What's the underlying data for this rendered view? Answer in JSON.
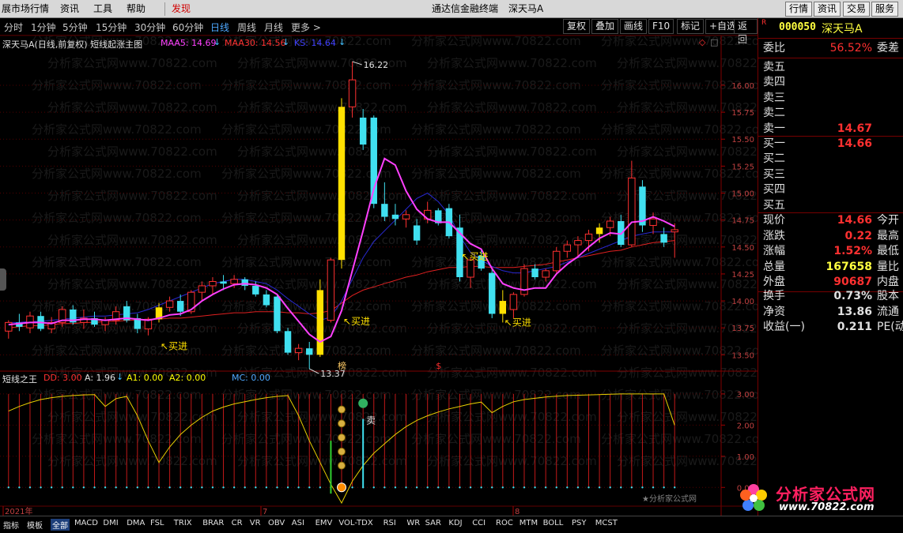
{
  "menubar": {
    "items": [
      "展市场行情",
      "资讯",
      "工具",
      "帮助"
    ],
    "discover": "发现",
    "app_title": "通达信金融终端",
    "stock_title": "深天马A",
    "right_buttons": [
      "行情",
      "资讯",
      "交易",
      "服务"
    ]
  },
  "periodbar": {
    "periods": [
      "分时",
      "1分钟",
      "5分钟",
      "15分钟",
      "30分钟",
      "60分钟",
      "日线",
      "周线",
      "月线",
      "更多 >"
    ],
    "active": "日线",
    "tools": [
      "复权",
      "叠加",
      "画线",
      "F10",
      "标记",
      "+自选",
      "返回"
    ]
  },
  "main_chart": {
    "title": "深天马A(日线,前复权) 短线起涨主图",
    "ma_labels": [
      {
        "text": "MAA5: 14.69",
        "color": "#ff40ff"
      },
      {
        "text": "MAA30: 14.56",
        "color": "#ff3030"
      },
      {
        "text": "KS: 14.64",
        "color": "#4040ff"
      }
    ],
    "price_axis": [
      "16.00",
      "15.75",
      "15.50",
      "15.25",
      "15.00",
      "14.75",
      "14.50",
      "14.25",
      "14.00",
      "13.75",
      "13.50"
    ],
    "high_label": "16.22",
    "low_label": "13.37",
    "buy_label": "买进",
    "buy_label_2": "买进",
    "buy_label_3": "买进",
    "buy_label_4": "买进",
    "event_marks": [
      "榜",
      "$"
    ]
  },
  "sub_chart": {
    "title": "短线之王",
    "indicators": [
      {
        "text": "DD: 3.00",
        "color": "#ff3030"
      },
      {
        "text": "A: 1.96",
        "color": "#e0e0e0"
      },
      {
        "text": "A1: 0.00",
        "color": "#ffff00"
      },
      {
        "text": "A2: 0.00",
        "color": "#ffff00"
      },
      {
        "text": "MC: 0.00",
        "color": "#4ea8ff"
      }
    ],
    "axis": [
      "3.00",
      "2.00",
      "1.00",
      "0.00"
    ],
    "sell_label": "卖",
    "date_labels": [
      "2021年",
      "7",
      "8"
    ],
    "footer_mark": "★分析家公式网"
  },
  "panel": {
    "flag": "R",
    "code": "000050",
    "name": "深天马A",
    "rows1": [
      {
        "label": "委比",
        "value": "56.52%",
        "value_color": "#ff3030",
        "right": "委差"
      }
    ],
    "sell_rows": [
      {
        "label": "卖五",
        "value": ""
      },
      {
        "label": "卖四",
        "value": ""
      },
      {
        "label": "卖三",
        "value": ""
      },
      {
        "label": "卖二",
        "value": ""
      },
      {
        "label": "卖一",
        "value": "14.67"
      }
    ],
    "buy_rows": [
      {
        "label": "买一",
        "value": "14.66"
      },
      {
        "label": "买二",
        "value": ""
      },
      {
        "label": "买三",
        "value": ""
      },
      {
        "label": "买四",
        "value": ""
      },
      {
        "label": "买五",
        "value": ""
      }
    ],
    "stats": [
      {
        "label": "现价",
        "value": "14.66",
        "value_color": "#ff3030",
        "right": "今开"
      },
      {
        "label": "涨跌",
        "value": "0.22",
        "value_color": "#ff3030",
        "right": "最高"
      },
      {
        "label": "涨幅",
        "value": "1.52%",
        "value_color": "#ff3030",
        "right": "最低"
      },
      {
        "label": "总量",
        "value": "167658",
        "value_color": "#ffff40",
        "right": "量比"
      },
      {
        "label": "外盘",
        "value": "90687",
        "value_color": "#ff3030",
        "right": "内盘"
      }
    ],
    "stats2": [
      {
        "label": "换手",
        "value": "0.73%",
        "value_color": "#e0e0e0",
        "right": "股本"
      },
      {
        "label": "净资",
        "value": "13.86",
        "value_color": "#e0e0e0",
        "right": "流通"
      },
      {
        "label": "收益(一)",
        "value": "0.211",
        "value_color": "#e0e0e0",
        "right": "PE(动)"
      }
    ]
  },
  "tabbar": {
    "tabs": [
      "指标",
      "模板",
      "全部",
      "MACD",
      "DMI",
      "DMA",
      "FSL",
      "TRIX",
      "BRAR",
      "CR",
      "VR",
      "OBV",
      "ASI",
      "EMV",
      "VOL-TDX",
      "RSI",
      "WR",
      "SAR",
      "KDJ",
      "CCI",
      "ROC",
      "MTM",
      "BOLL",
      "PSY",
      "MCST"
    ],
    "active": "全部"
  },
  "logo": {
    "text": "分析家公式网",
    "url": "www.70822.com"
  },
  "watermark": "分析家公式网www.70822.com",
  "chart_data": {
    "type": "candlestick",
    "title": "深天马A(日线,前复权) 短线起涨主图",
    "ylim": [
      13.4,
      16.3
    ],
    "up_color": "#ff3030",
    "down_color": "#40e0f0",
    "candles": [
      {
        "o": 13.72,
        "h": 13.82,
        "l": 13.65,
        "c": 13.8
      },
      {
        "o": 13.8,
        "h": 13.88,
        "l": 13.72,
        "c": 13.76
      },
      {
        "o": 13.75,
        "h": 13.9,
        "l": 13.7,
        "c": 13.86
      },
      {
        "o": 13.86,
        "h": 13.9,
        "l": 13.72,
        "c": 13.74
      },
      {
        "o": 13.74,
        "h": 13.85,
        "l": 13.7,
        "c": 13.8
      },
      {
        "o": 13.8,
        "h": 13.95,
        "l": 13.76,
        "c": 13.92
      },
      {
        "o": 13.92,
        "h": 13.96,
        "l": 13.78,
        "c": 13.8
      },
      {
        "o": 13.8,
        "h": 13.92,
        "l": 13.74,
        "c": 13.84
      },
      {
        "o": 13.84,
        "h": 13.9,
        "l": 13.76,
        "c": 13.78
      },
      {
        "o": 13.78,
        "h": 13.85,
        "l": 13.72,
        "c": 13.82
      },
      {
        "o": 13.82,
        "h": 13.95,
        "l": 13.78,
        "c": 13.9
      },
      {
        "o": 13.95,
        "h": 14.0,
        "l": 13.8,
        "c": 13.82
      },
      {
        "o": 13.84,
        "h": 13.88,
        "l": 13.7,
        "c": 13.74
      },
      {
        "o": 13.74,
        "h": 13.85,
        "l": 13.68,
        "c": 13.83
      },
      {
        "o": 13.83,
        "h": 13.98,
        "l": 13.8,
        "c": 13.94
      },
      {
        "o": 13.94,
        "h": 14.04,
        "l": 13.9,
        "c": 14.0
      },
      {
        "o": 14.0,
        "h": 14.06,
        "l": 13.86,
        "c": 13.9
      },
      {
        "o": 13.9,
        "h": 14.1,
        "l": 13.88,
        "c": 14.08
      },
      {
        "o": 14.08,
        "h": 14.18,
        "l": 14.0,
        "c": 14.14
      },
      {
        "o": 14.14,
        "h": 14.22,
        "l": 14.06,
        "c": 14.18
      },
      {
        "o": 14.18,
        "h": 14.24,
        "l": 14.1,
        "c": 14.16
      },
      {
        "o": 14.16,
        "h": 14.24,
        "l": 14.12,
        "c": 14.2
      },
      {
        "o": 14.2,
        "h": 14.22,
        "l": 14.1,
        "c": 14.14
      },
      {
        "o": 14.14,
        "h": 14.18,
        "l": 14.04,
        "c": 14.06
      },
      {
        "o": 14.06,
        "h": 14.1,
        "l": 13.94,
        "c": 13.96
      },
      {
        "o": 14.04,
        "h": 14.06,
        "l": 13.7,
        "c": 13.72
      },
      {
        "o": 13.72,
        "h": 13.75,
        "l": 13.5,
        "c": 13.52
      },
      {
        "o": 13.52,
        "h": 13.6,
        "l": 13.45,
        "c": 13.56
      },
      {
        "o": 13.56,
        "h": 13.62,
        "l": 13.37,
        "c": 13.5
      },
      {
        "o": 13.5,
        "h": 14.2,
        "l": 13.48,
        "c": 14.1
      },
      {
        "o": 13.82,
        "h": 14.4,
        "l": 13.8,
        "c": 14.38
      },
      {
        "o": 14.38,
        "h": 15.88,
        "l": 14.3,
        "c": 15.8
      },
      {
        "o": 15.8,
        "h": 16.22,
        "l": 15.7,
        "c": 16.05
      },
      {
        "o": 15.7,
        "h": 15.78,
        "l": 15.4,
        "c": 15.45
      },
      {
        "o": 15.7,
        "h": 15.72,
        "l": 14.86,
        "c": 14.9
      },
      {
        "o": 14.9,
        "h": 15.1,
        "l": 14.74,
        "c": 14.78
      },
      {
        "o": 14.8,
        "h": 14.9,
        "l": 14.7,
        "c": 14.76
      },
      {
        "o": 14.76,
        "h": 14.84,
        "l": 14.68,
        "c": 14.8
      },
      {
        "o": 14.7,
        "h": 14.76,
        "l": 14.52,
        "c": 14.56
      },
      {
        "o": 14.76,
        "h": 14.92,
        "l": 14.72,
        "c": 14.84
      },
      {
        "o": 14.84,
        "h": 14.86,
        "l": 14.7,
        "c": 14.72
      },
      {
        "o": 14.86,
        "h": 14.9,
        "l": 14.58,
        "c": 14.6
      },
      {
        "o": 14.68,
        "h": 14.8,
        "l": 14.18,
        "c": 14.22
      },
      {
        "o": 14.22,
        "h": 14.4,
        "l": 14.12,
        "c": 14.38
      },
      {
        "o": 14.42,
        "h": 14.48,
        "l": 14.28,
        "c": 14.3
      },
      {
        "o": 14.26,
        "h": 14.3,
        "l": 13.84,
        "c": 13.88
      },
      {
        "o": 13.88,
        "h": 14.1,
        "l": 13.8,
        "c": 14.0
      },
      {
        "o": 13.92,
        "h": 14.08,
        "l": 13.84,
        "c": 14.06
      },
      {
        "o": 14.06,
        "h": 14.34,
        "l": 14.04,
        "c": 14.3
      },
      {
        "o": 14.3,
        "h": 14.34,
        "l": 14.2,
        "c": 14.22
      },
      {
        "o": 14.22,
        "h": 14.3,
        "l": 14.18,
        "c": 14.28
      },
      {
        "o": 14.28,
        "h": 14.5,
        "l": 14.26,
        "c": 14.46
      },
      {
        "o": 14.46,
        "h": 14.56,
        "l": 14.4,
        "c": 14.52
      },
      {
        "o": 14.52,
        "h": 14.6,
        "l": 14.4,
        "c": 14.56
      },
      {
        "o": 14.56,
        "h": 14.66,
        "l": 14.46,
        "c": 14.62
      },
      {
        "o": 14.62,
        "h": 14.72,
        "l": 14.54,
        "c": 14.68
      },
      {
        "o": 14.68,
        "h": 14.78,
        "l": 14.6,
        "c": 14.74
      },
      {
        "o": 14.74,
        "h": 14.8,
        "l": 14.5,
        "c": 14.52
      },
      {
        "o": 14.52,
        "h": 15.3,
        "l": 14.5,
        "c": 15.14
      },
      {
        "o": 15.06,
        "h": 15.12,
        "l": 14.64,
        "c": 14.7
      },
      {
        "o": 14.7,
        "h": 14.82,
        "l": 14.62,
        "c": 14.76
      },
      {
        "o": 14.62,
        "h": 14.68,
        "l": 14.5,
        "c": 14.54
      },
      {
        "o": 14.64,
        "h": 14.72,
        "l": 14.4,
        "c": 14.66
      }
    ],
    "ma5": [
      13.78,
      13.79,
      13.8,
      13.8,
      13.79,
      13.82,
      13.82,
      13.83,
      13.83,
      13.82,
      13.83,
      13.84,
      13.83,
      13.82,
      13.84,
      13.87,
      13.88,
      13.92,
      14.0,
      14.06,
      14.11,
      14.15,
      14.16,
      14.15,
      14.12,
      14.06,
      13.93,
      13.81,
      13.69,
      13.62,
      13.67,
      13.91,
      14.28,
      14.65,
      15.04,
      15.32,
      15.26,
      15.02,
      14.85,
      14.76,
      14.73,
      14.73,
      14.63,
      14.53,
      14.48,
      14.3,
      14.16,
      14.12,
      14.1,
      14.12,
      14.12,
      14.25,
      14.34,
      14.41,
      14.5,
      14.58,
      14.63,
      14.62,
      14.73,
      14.74,
      14.78,
      14.74,
      14.69
    ],
    "ma30": [
      13.75,
      13.76,
      13.77,
      13.77,
      13.78,
      13.79,
      13.79,
      13.8,
      13.8,
      13.81,
      13.81,
      13.82,
      13.82,
      13.83,
      13.83,
      13.84,
      13.84,
      13.85,
      13.86,
      13.87,
      13.88,
      13.89,
      13.89,
      13.9,
      13.9,
      13.9,
      13.89,
      13.89,
      13.88,
      13.89,
      13.91,
      13.98,
      14.05,
      14.1,
      14.13,
      14.16,
      14.19,
      14.22,
      14.24,
      14.27,
      14.29,
      14.31,
      14.31,
      14.32,
      14.32,
      14.31,
      14.31,
      14.31,
      14.32,
      14.33,
      14.34,
      14.36,
      14.38,
      14.4,
      14.42,
      14.44,
      14.46,
      14.47,
      14.5,
      14.52,
      14.54,
      14.55,
      14.56
    ],
    "ks": [
      13.8,
      13.8,
      13.81,
      13.81,
      13.82,
      13.83,
      13.84,
      13.85,
      13.86,
      13.86,
      13.87,
      13.88,
      13.89,
      13.92,
      13.96,
      14.0,
      14.04,
      14.08,
      14.12,
      14.16,
      14.18,
      14.2,
      14.2,
      14.18,
      14.16,
      14.1,
      14.02,
      13.95,
      13.88,
      13.82,
      13.85,
      14.0,
      14.2,
      14.4,
      14.55,
      14.65,
      14.75,
      14.85,
      14.95,
      15.0,
      14.92,
      14.8,
      14.6,
      14.45,
      14.38,
      14.32,
      14.28,
      14.26,
      14.26,
      14.28,
      14.3,
      14.32,
      14.36,
      14.4,
      14.44,
      14.48,
      14.52,
      14.56,
      14.6,
      14.62,
      14.64,
      14.64,
      14.64
    ],
    "buy_signals": [
      14,
      31,
      46,
      55
    ],
    "sub_indicator": {
      "name": "短线之王",
      "ylim": [
        -0.5,
        3.2
      ],
      "line": [
        2.45,
        2.6,
        2.72,
        2.82,
        2.88,
        2.92,
        2.95,
        2.97,
        2.98,
        2.6,
        2.85,
        2.92,
        2.3,
        1.5,
        0.8,
        1.3,
        1.7,
        2.0,
        2.25,
        2.45,
        2.58,
        2.68,
        2.75,
        2.82,
        2.88,
        2.92,
        2.95,
        2.3,
        1.5,
        0.8,
        0.1,
        -0.5,
        0.2,
        0.7,
        1.1,
        1.4,
        1.7,
        1.95,
        2.15,
        2.3,
        2.42,
        2.52,
        2.6,
        2.68,
        2.74,
        2.4,
        2.6,
        2.75,
        2.82,
        2.86,
        2.9,
        2.93,
        2.95,
        2.96,
        2.97,
        2.98,
        2.99,
        3.0,
        3.0,
        3.0,
        3.0,
        3.0,
        2.0
      ]
    }
  }
}
